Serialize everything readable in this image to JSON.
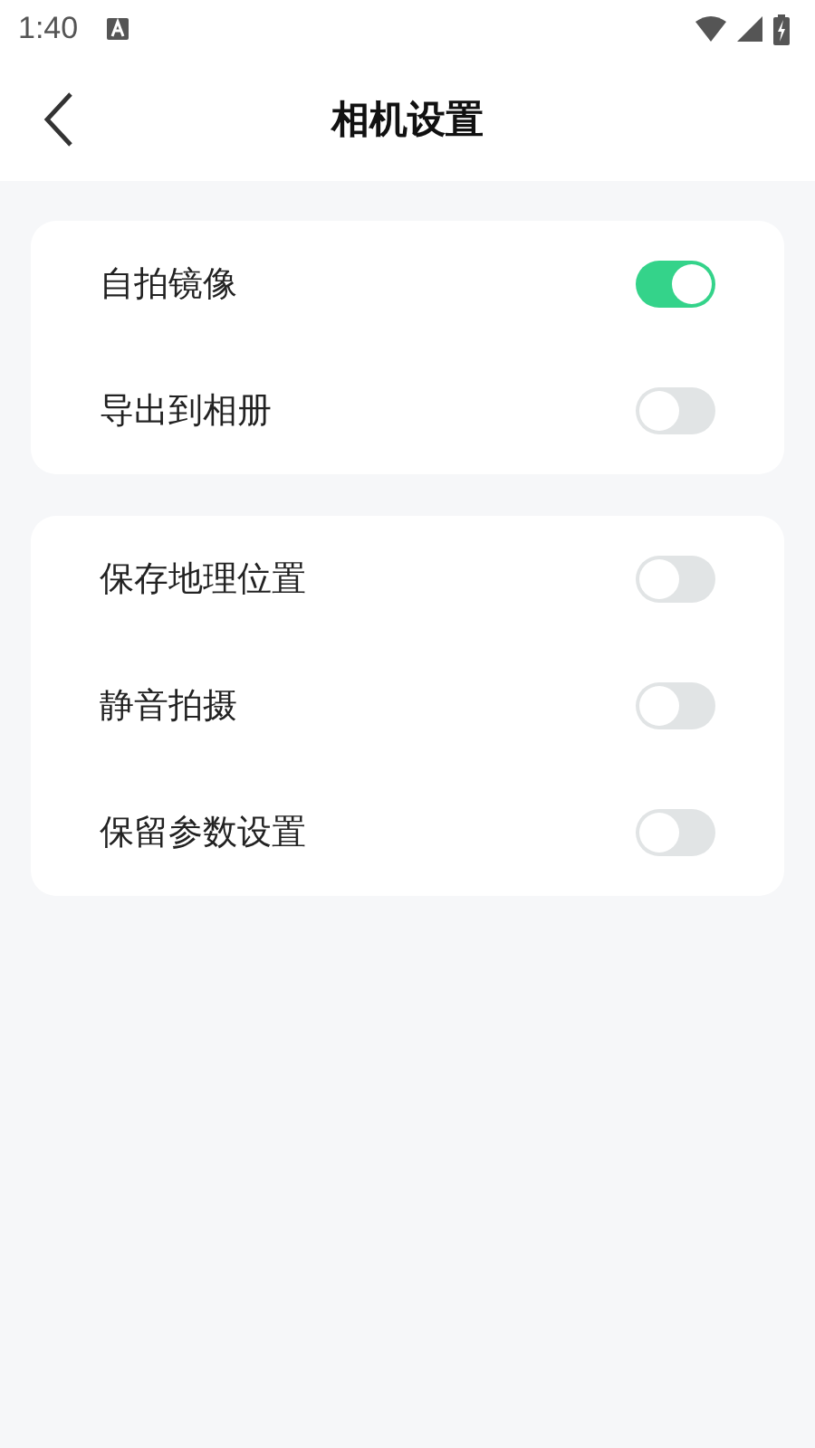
{
  "status_bar": {
    "time": "1:40"
  },
  "header": {
    "title": "相机设置"
  },
  "groups": [
    {
      "items": [
        {
          "label": "自拍镜像",
          "on": true
        },
        {
          "label": "导出到相册",
          "on": false
        }
      ]
    },
    {
      "items": [
        {
          "label": "保存地理位置",
          "on": false
        },
        {
          "label": "静音拍摄",
          "on": false
        },
        {
          "label": "保留参数设置",
          "on": false
        }
      ]
    }
  ]
}
